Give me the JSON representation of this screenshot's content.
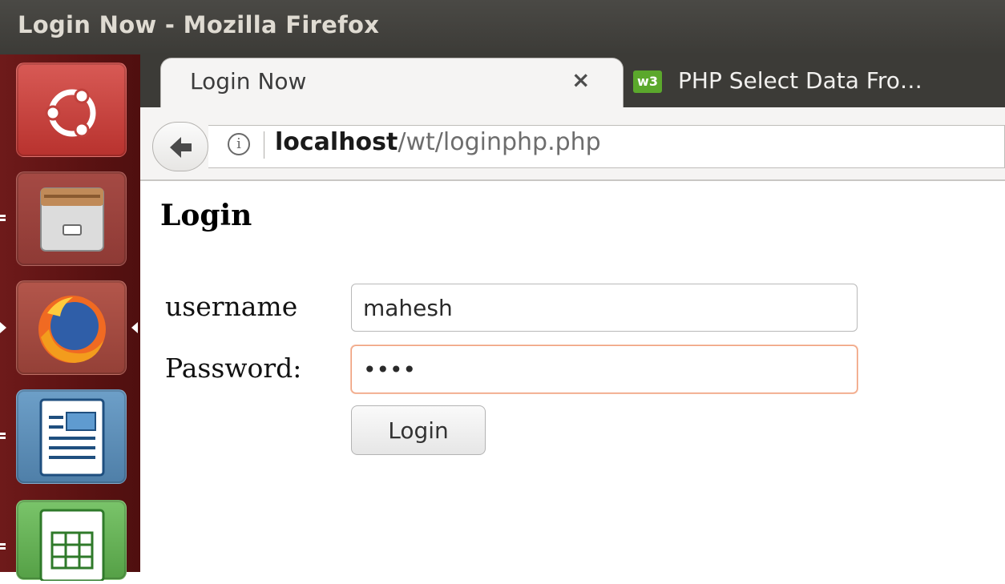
{
  "window": {
    "title": "Login Now - Mozilla Firefox"
  },
  "launcher": {
    "items": [
      {
        "name": "ubuntu-dash",
        "icon": "ubuntu-logo-icon"
      },
      {
        "name": "files",
        "icon": "file-cabinet-icon"
      },
      {
        "name": "firefox",
        "icon": "firefox-icon"
      },
      {
        "name": "libreoffice-writer",
        "icon": "document-icon"
      },
      {
        "name": "libreoffice-calc",
        "icon": "spreadsheet-icon"
      }
    ]
  },
  "browser": {
    "tabs": [
      {
        "label": "Login Now",
        "active": true,
        "close": "×"
      },
      {
        "label": "PHP Select Data Fro…",
        "active": false,
        "favicon": "w3schools-icon",
        "favicon_text": "w3"
      }
    ],
    "url": {
      "host": "localhost",
      "path": "/wt/loginphp.php"
    },
    "info_glyph": "i"
  },
  "page": {
    "heading": "Login",
    "username_label": "username",
    "username_value": "mahesh",
    "password_label": "Password:",
    "password_value": "••••",
    "login_button": "Login"
  },
  "colors": {
    "launcher": "#5b1212",
    "titlebar": "#3c3b37",
    "tab_active": "#f5f4f3",
    "focus_border": "#f0a17e"
  }
}
